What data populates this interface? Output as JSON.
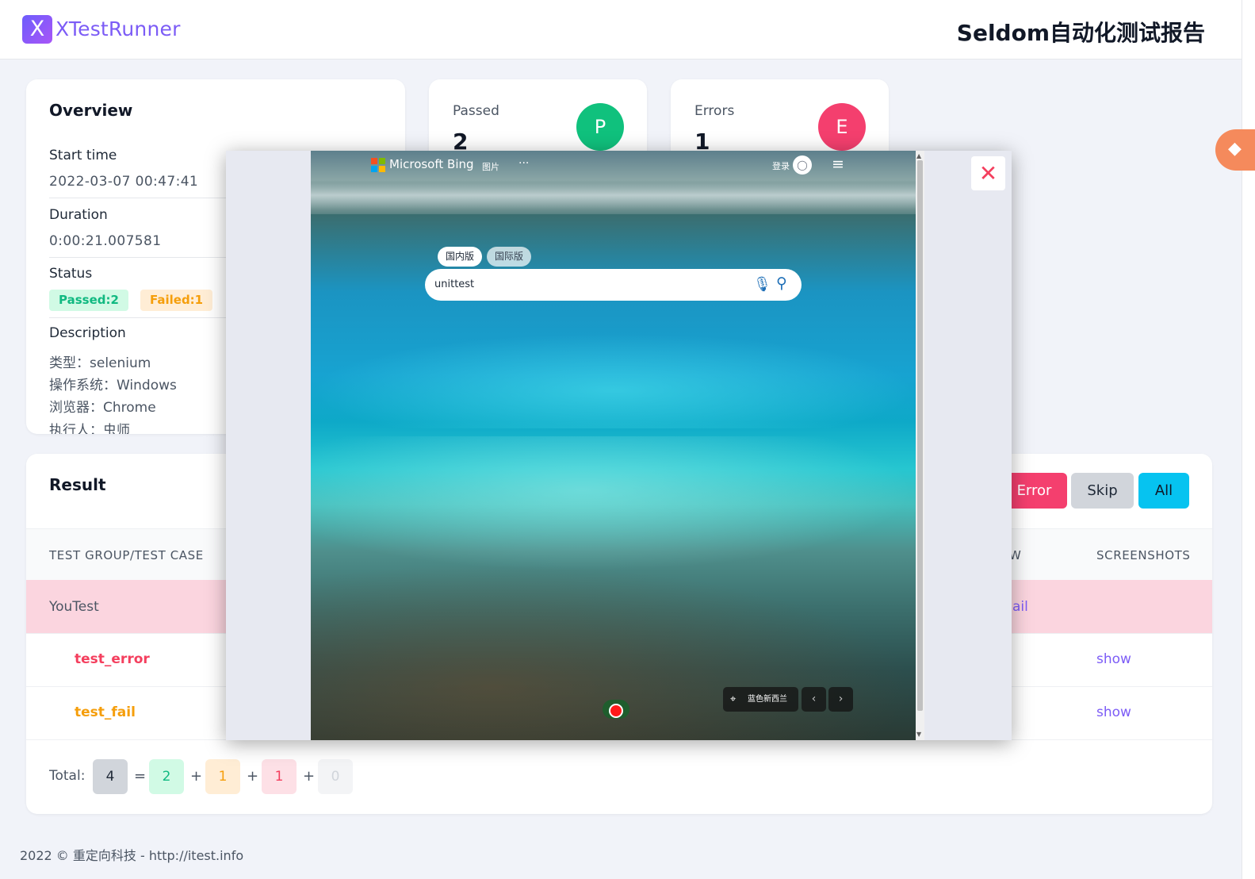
{
  "header": {
    "logo_letter": "X",
    "logo_text": "XTestRunner",
    "report_title": "Seldom自动化测试报告"
  },
  "overview": {
    "title": "Overview",
    "start_time_label": "Start time",
    "start_time": "2022-03-07 00:47:41",
    "duration_label": "Duration",
    "duration": "0:00:21.007581",
    "status_label": "Status",
    "status_passed": "Passed:2",
    "status_failed": "Failed:1",
    "description_label": "Description",
    "description_lines": [
      "类型：selenium",
      "操作系统：Windows",
      "浏览器：Chrome",
      "执行人：虫师"
    ]
  },
  "stats": [
    {
      "label": "Passed",
      "value": "2",
      "letter": "P",
      "color": "#10c17d"
    },
    {
      "label": "Errors",
      "value": "1",
      "letter": "E",
      "color": "#f43f6e"
    }
  ],
  "result": {
    "title": "Result",
    "filters": [
      "Error",
      "Skip",
      "All"
    ],
    "columns": {
      "case": "TEST GROUP/TEST CASE",
      "view_partial": "W",
      "screenshots": "SCREENSHOTS"
    },
    "group_name": "YouTest",
    "group_detail_partial": "ail",
    "cases": [
      {
        "name": "test_error",
        "screenshot": "show"
      },
      {
        "name": "test_fail",
        "screenshot": "show"
      }
    ],
    "total_label": "Total:",
    "total": "4",
    "passed": "2",
    "failed": "1",
    "errors": "1",
    "skipped": "0",
    "equals": "=",
    "plus": "+"
  },
  "footer": "2022 © 重定向科技 - http://itest.info",
  "modal": {
    "close": "✕",
    "bing": {
      "brand": "Microsoft Bing",
      "nav_images": "图片",
      "more": "···",
      "login": "登录",
      "tab_domestic": "国内版",
      "tab_international": "国际版",
      "query": "unittest",
      "location": "蓝色新西兰",
      "prev": "‹",
      "next": "›"
    }
  },
  "colors": {
    "accent": "#7c5cf6",
    "error": "#f43f5e",
    "fail": "#f59e0b",
    "pass": "#10b981",
    "all": "#06c3f0"
  }
}
